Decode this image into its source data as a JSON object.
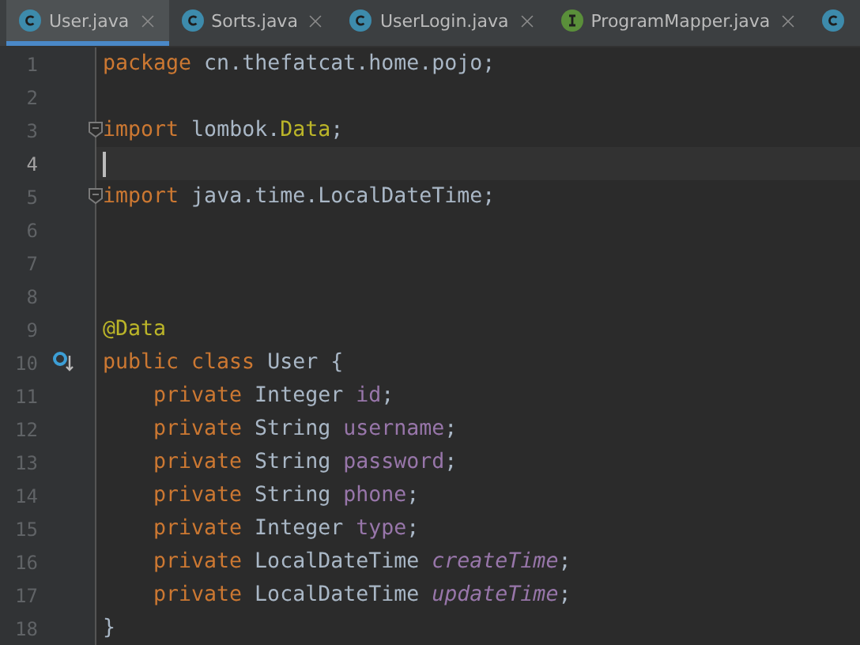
{
  "tabs": [
    {
      "label": "User.java",
      "kind": "class",
      "selected": true
    },
    {
      "label": "Sorts.java",
      "kind": "class",
      "selected": false
    },
    {
      "label": "UserLogin.java",
      "kind": "class",
      "selected": false
    },
    {
      "label": "ProgramMapper.java",
      "kind": "interface",
      "selected": false
    },
    {
      "kind": "class",
      "selected": false
    }
  ],
  "lines": [
    {
      "number": "1",
      "tokens": [
        {
          "kind": "keyword",
          "text": "package"
        },
        {
          "kind": "plain",
          "text": " cn.thefatcat.home.pojo;"
        }
      ]
    },
    {
      "number": "2"
    },
    {
      "number": "3",
      "fold": true,
      "tokens": [
        {
          "kind": "keyword",
          "text": "import"
        },
        {
          "kind": "plain",
          "text": " lombok."
        },
        {
          "kind": "annotation",
          "text": "Data"
        },
        {
          "kind": "plain",
          "text": ";"
        }
      ]
    },
    {
      "number": "4",
      "current": true
    },
    {
      "number": "5",
      "fold": true,
      "tokens": [
        {
          "kind": "keyword",
          "text": "import"
        },
        {
          "kind": "plain",
          "text": " java.time.LocalDateTime;"
        }
      ]
    },
    {
      "number": "6"
    },
    {
      "number": "7"
    },
    {
      "number": "8"
    },
    {
      "number": "9",
      "tokens": [
        {
          "kind": "annotation",
          "text": "@Data"
        }
      ]
    },
    {
      "number": "10",
      "gutter_marker": true,
      "tokens": [
        {
          "kind": "keyword",
          "text": "public class"
        },
        {
          "kind": "plain",
          "text": " User {"
        }
      ]
    },
    {
      "number": "11",
      "indented": true,
      "tokens": [
        {
          "kind": "keyword",
          "text": "private"
        },
        {
          "kind": "plain",
          "text": " Integer "
        },
        {
          "kind": "field",
          "text": "id"
        },
        {
          "kind": "plain",
          "text": ";"
        }
      ]
    },
    {
      "number": "12",
      "indented": true,
      "tokens": [
        {
          "kind": "keyword",
          "text": "private"
        },
        {
          "kind": "plain",
          "text": " String "
        },
        {
          "kind": "field",
          "text": "username"
        },
        {
          "kind": "plain",
          "text": ";"
        }
      ]
    },
    {
      "number": "13",
      "indented": true,
      "tokens": [
        {
          "kind": "keyword",
          "text": "private"
        },
        {
          "kind": "plain",
          "text": " String "
        },
        {
          "kind": "field",
          "text": "password"
        },
        {
          "kind": "plain",
          "text": ";"
        }
      ]
    },
    {
      "number": "14",
      "indented": true,
      "tokens": [
        {
          "kind": "keyword",
          "text": "private"
        },
        {
          "kind": "plain",
          "text": " String "
        },
        {
          "kind": "field",
          "text": "phone"
        },
        {
          "kind": "plain",
          "text": ";"
        }
      ]
    },
    {
      "number": "15",
      "indented": true,
      "tokens": [
        {
          "kind": "keyword",
          "text": "private"
        },
        {
          "kind": "plain",
          "text": " Integer "
        },
        {
          "kind": "field",
          "text": "type"
        },
        {
          "kind": "plain",
          "text": ";"
        }
      ]
    },
    {
      "number": "16",
      "indented": true,
      "tokens": [
        {
          "kind": "keyword",
          "text": "private"
        },
        {
          "kind": "plain",
          "text": " LocalDateTime "
        },
        {
          "kind": "field_italic",
          "text": "createTime"
        },
        {
          "kind": "plain",
          "text": ";"
        }
      ]
    },
    {
      "number": "17",
      "indented": true,
      "tokens": [
        {
          "kind": "keyword",
          "text": "private"
        },
        {
          "kind": "plain",
          "text": " LocalDateTime "
        },
        {
          "kind": "field_italic",
          "text": "updateTime"
        },
        {
          "kind": "plain",
          "text": ";"
        }
      ]
    },
    {
      "number": "18",
      "tokens": [
        {
          "kind": "plain",
          "text": "}"
        }
      ]
    }
  ]
}
